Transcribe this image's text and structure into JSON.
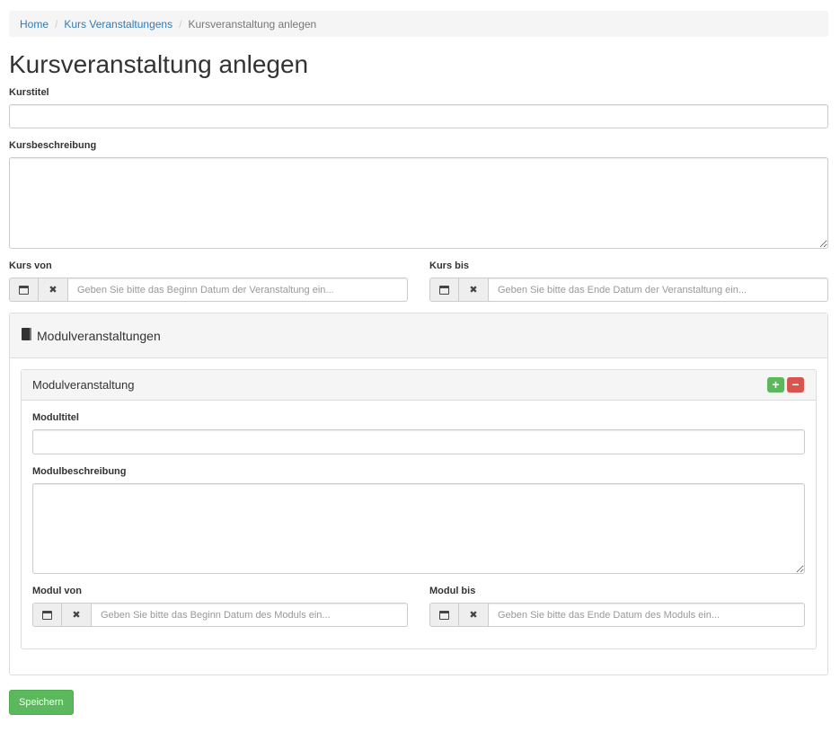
{
  "breadcrumb": {
    "items": [
      "Home",
      "Kurs Veranstaltungens"
    ],
    "active": "Kursveranstaltung anlegen"
  },
  "page_title": "Kursveranstaltung anlegen",
  "form": {
    "kurstitel_label": "Kurstitel",
    "kurstitel_value": "",
    "kursbeschreibung_label": "Kursbeschreibung",
    "kursbeschreibung_value": "",
    "kurs_von_label": "Kurs von",
    "kurs_von_placeholder": "Geben Sie bitte das Beginn Datum der Veranstaltung ein...",
    "kurs_bis_label": "Kurs bis",
    "kurs_bis_placeholder": "Geben Sie bitte das Ende Datum der Veranstaltung ein..."
  },
  "module_panel": {
    "title": "Modulveranstaltungen",
    "item_title": "Modulveranstaltung",
    "add_symbol": "+",
    "remove_symbol": "−",
    "add_color": "#5cb85c",
    "remove_color": "#d9534f",
    "modultitel_label": "Modultitel",
    "modultitel_value": "",
    "modulbeschreibung_label": "Modulbeschreibung",
    "modulbeschreibung_value": "",
    "modul_von_label": "Modul von",
    "modul_von_placeholder": "Geben Sie bitte das Beginn Datum des Moduls ein...",
    "modul_bis_label": "Modul bis",
    "modul_bis_placeholder": "Geben Sie bitte das Ende Datum des Moduls ein..."
  },
  "icons": {
    "calendar": "calendar-icon",
    "clear": "✖",
    "book": "book-icon"
  },
  "save_label": "Speichern"
}
